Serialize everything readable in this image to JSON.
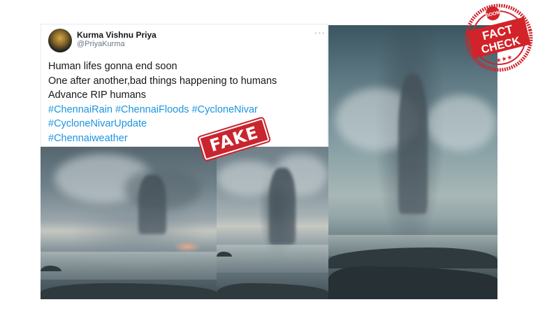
{
  "tweet": {
    "author_name": "Kurma Vishnu Priya",
    "author_handle": "@PriyaKurma",
    "lines": [
      "Human lifes gonna end soon",
      "One after another,bad things happening to humans",
      "Advance RIP humans"
    ],
    "hashtag_lines": [
      [
        "#ChennaiRain",
        "#ChennaiFloods",
        "#CycloneNivar"
      ],
      [
        "#CycloneNivarUpdate"
      ],
      [
        "#Chennaiweather"
      ]
    ]
  },
  "stamp": {
    "label": "FAKE",
    "color": "#c9252e"
  },
  "badge": {
    "brand": "BOOM",
    "line1": "FACT",
    "line2": "CHECK",
    "stars": "★★★",
    "color": "#d2232a"
  },
  "colors": {
    "hashtag": "#1b95e0",
    "text": "#14171a",
    "handle": "#657786"
  }
}
